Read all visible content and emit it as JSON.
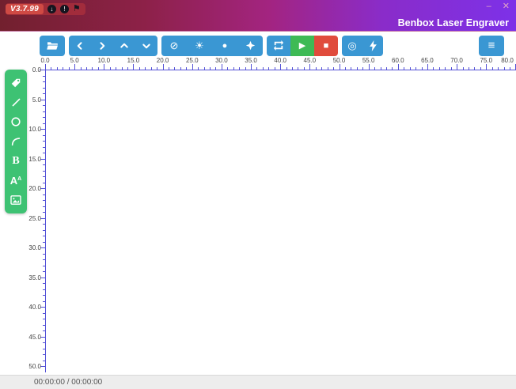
{
  "window": {
    "version_badge": "V3.7.99",
    "app_title": "Benbox Laser Engraver",
    "minimize_glyph": "–",
    "close_glyph": "✕",
    "badge_update_glyph": "↓",
    "badge_info_glyph": "!",
    "flag_glyph": "⚑"
  },
  "toolbar": {
    "glyphs": {
      "block": "⊘",
      "sun": "☀",
      "dot": "●",
      "play": "▶",
      "stop": "■",
      "focus": "◎",
      "bolt": "⚡",
      "menu": "≡"
    },
    "icon_names": [
      "open-folder",
      "move-left",
      "move-right",
      "move-up",
      "move-down",
      "laser-off",
      "laser-weak",
      "laser-dot",
      "laser-spark",
      "repeat",
      "start",
      "stop",
      "focus",
      "power",
      "menu"
    ]
  },
  "sidebar": {
    "tools": [
      "tag",
      "line",
      "ellipse",
      "arc",
      "bold-text",
      "text",
      "image"
    ],
    "bold_letter": "B",
    "text_letter": "A",
    "text_sup": "A"
  },
  "rulers": {
    "horizontal": {
      "unit_min": 0,
      "unit_max": 80,
      "major_step": 5,
      "minor_step": 1,
      "labels": [
        "0.0",
        "5.0",
        "10.0",
        "15.0",
        "20.0",
        "25.0",
        "30.0",
        "35.0",
        "40.0",
        "45.0",
        "50.0",
        "55.0",
        "60.0",
        "65.0",
        "70.0",
        "75.0",
        "80.0"
      ]
    },
    "vertical": {
      "unit_min": 0,
      "unit_max": 50,
      "major_step": 5,
      "minor_step": 1,
      "labels": [
        "0.0",
        "5.0",
        "10.0",
        "15.0",
        "20.0",
        "25.0",
        "30.0",
        "35.0",
        "40.0",
        "45.0",
        "50.0"
      ]
    }
  },
  "statusbar": {
    "time_text": "00:00:00 / 00:00:00"
  },
  "colors": {
    "toolbar_blue": "#3a97d3",
    "play_green": "#3eba55",
    "stop_red": "#e04b3c",
    "sidebar_green": "#3ec273",
    "ruler_blue": "#5351d6",
    "title_gradient_left": "#72202e",
    "title_gradient_right": "#7d31e8",
    "badge_red": "#cf4a44"
  }
}
